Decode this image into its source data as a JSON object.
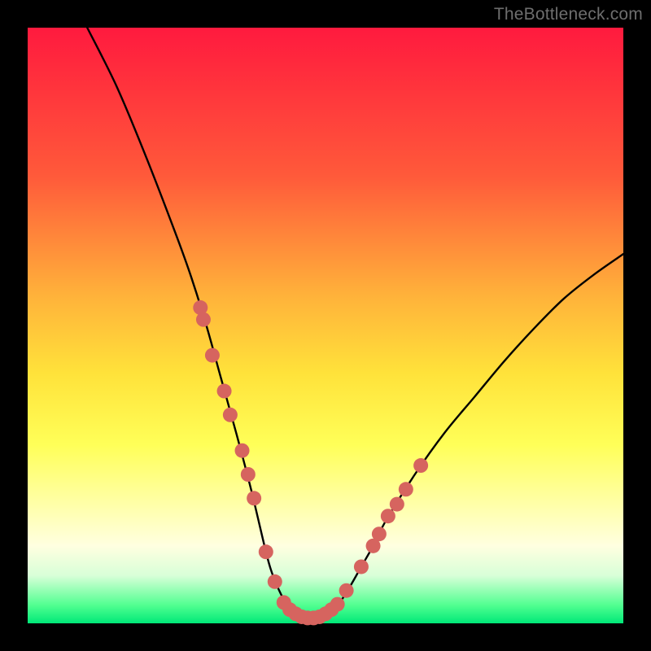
{
  "watermark": "TheBottleneck.com",
  "colors": {
    "frame": "#000000",
    "curve_stroke": "#000000",
    "marker_fill": "#d6645f",
    "marker_stroke": "#b84f4a"
  },
  "chart_data": {
    "type": "line",
    "title": "",
    "xlabel": "",
    "ylabel": "",
    "xlim": [
      0,
      100
    ],
    "ylim": [
      0,
      100
    ],
    "grid": false,
    "legend": false,
    "series": [
      {
        "name": "curve",
        "x": [
          10,
          15,
          20,
          25,
          27.5,
          30,
          32.5,
          35,
          37.5,
          40,
          41,
          42,
          43,
          44,
          45,
          46,
          47,
          48,
          49,
          50,
          52,
          54,
          56,
          58,
          60,
          65,
          70,
          75,
          80,
          85,
          90,
          95,
          100
        ],
        "y": [
          100,
          90,
          78,
          65,
          58,
          50,
          41,
          32,
          22.5,
          12,
          8.5,
          6,
          4,
          2.5,
          1.5,
          1,
          0.8,
          0.8,
          1,
          1.5,
          3,
          6,
          9.5,
          13,
          17,
          25,
          32,
          38,
          44,
          49.5,
          54.5,
          58.5,
          62
        ]
      }
    ],
    "markers": [
      {
        "x": 29,
        "y": 53
      },
      {
        "x": 29.5,
        "y": 51
      },
      {
        "x": 31,
        "y": 45
      },
      {
        "x": 33,
        "y": 39
      },
      {
        "x": 34,
        "y": 35
      },
      {
        "x": 36,
        "y": 29
      },
      {
        "x": 37,
        "y": 25
      },
      {
        "x": 38,
        "y": 21
      },
      {
        "x": 40,
        "y": 12
      },
      {
        "x": 41.5,
        "y": 7
      },
      {
        "x": 43,
        "y": 3.5
      },
      {
        "x": 44,
        "y": 2.3
      },
      {
        "x": 45,
        "y": 1.6
      },
      {
        "x": 46,
        "y": 1.1
      },
      {
        "x": 47,
        "y": 0.9
      },
      {
        "x": 48,
        "y": 0.9
      },
      {
        "x": 49,
        "y": 1.1
      },
      {
        "x": 50,
        "y": 1.6
      },
      {
        "x": 51,
        "y": 2.3
      },
      {
        "x": 52,
        "y": 3.2
      },
      {
        "x": 53.5,
        "y": 5.5
      },
      {
        "x": 56,
        "y": 9.5
      },
      {
        "x": 58,
        "y": 13
      },
      {
        "x": 59,
        "y": 15
      },
      {
        "x": 60.5,
        "y": 18
      },
      {
        "x": 62,
        "y": 20
      },
      {
        "x": 63.5,
        "y": 22.5
      },
      {
        "x": 66,
        "y": 26.5
      }
    ]
  }
}
